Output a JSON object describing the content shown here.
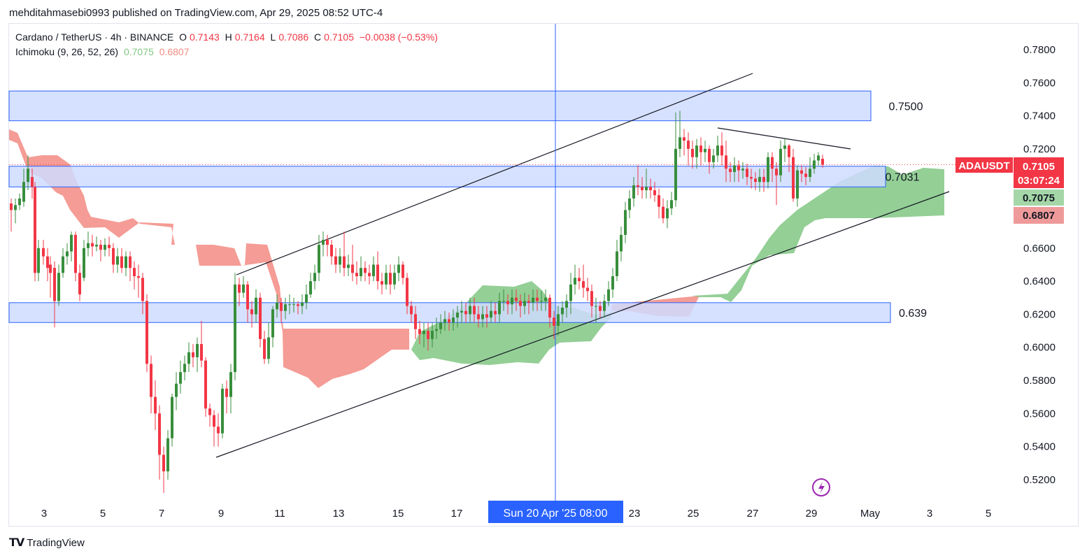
{
  "header": {
    "publisher": "mehditahmasebi0993 published on TradingView.com, Apr 29, 2025 08:52 UTC-4"
  },
  "legend": {
    "symbol": "Cardano / TetherUS · 4h · BINANCE",
    "open_label": "O",
    "open": "0.7143",
    "high_label": "H",
    "high": "0.7164",
    "low_label": "L",
    "low": "0.7086",
    "close_label": "C",
    "close": "0.7105",
    "change": "−0.0038 (−0.53%)",
    "indicator": "Ichimoku (9, 26, 52, 26)",
    "ind_val1": "0.7075",
    "ind_val2": "0.6807"
  },
  "footer": {
    "brand": "TradingView"
  },
  "colors": {
    "up": "#26a69a",
    "candle_up": "#388e3c",
    "candle_down": "#f23645",
    "cloud_green": "#81c784",
    "cloud_red": "#f28b82",
    "zone": "#cfdcff",
    "zone_border": "#2962ff",
    "crosshair": "#2962ff"
  },
  "chart_data": {
    "type": "candlestick",
    "ylim": [
      0.51,
      0.79
    ],
    "y_ticks": [
      "0.7800",
      "0.7600",
      "0.7400",
      "0.7200",
      "0.7000",
      "0.6800",
      "0.6600",
      "0.6400",
      "0.6200",
      "0.6000",
      "0.5800",
      "0.5600",
      "0.5400",
      "0.5200"
    ],
    "x_ticks": [
      "3",
      "5",
      "7",
      "9",
      "11",
      "13",
      "15",
      "17",
      "23",
      "25",
      "27",
      "29",
      "May",
      "3",
      "5"
    ],
    "crosshair_label": "Sun 20 Apr '25   08:00",
    "price_tags": [
      {
        "label": "ADAUSDT",
        "value": "0.7105",
        "sub": "03:07:24",
        "color": "#f23645"
      },
      {
        "label": "",
        "value": "0.7075",
        "color": "#a5d6a7"
      },
      {
        "label": "",
        "value": "0.6807",
        "color": "#ef9a9a"
      }
    ],
    "zones": [
      {
        "label": "0.7500",
        "from": 0.755,
        "to": 0.737
      },
      {
        "label": "0.7031",
        "from": 0.7095,
        "to": 0.697
      },
      {
        "label": "0.639",
        "from": 0.627,
        "to": 0.615
      }
    ],
    "last_price": 0.7105
  }
}
